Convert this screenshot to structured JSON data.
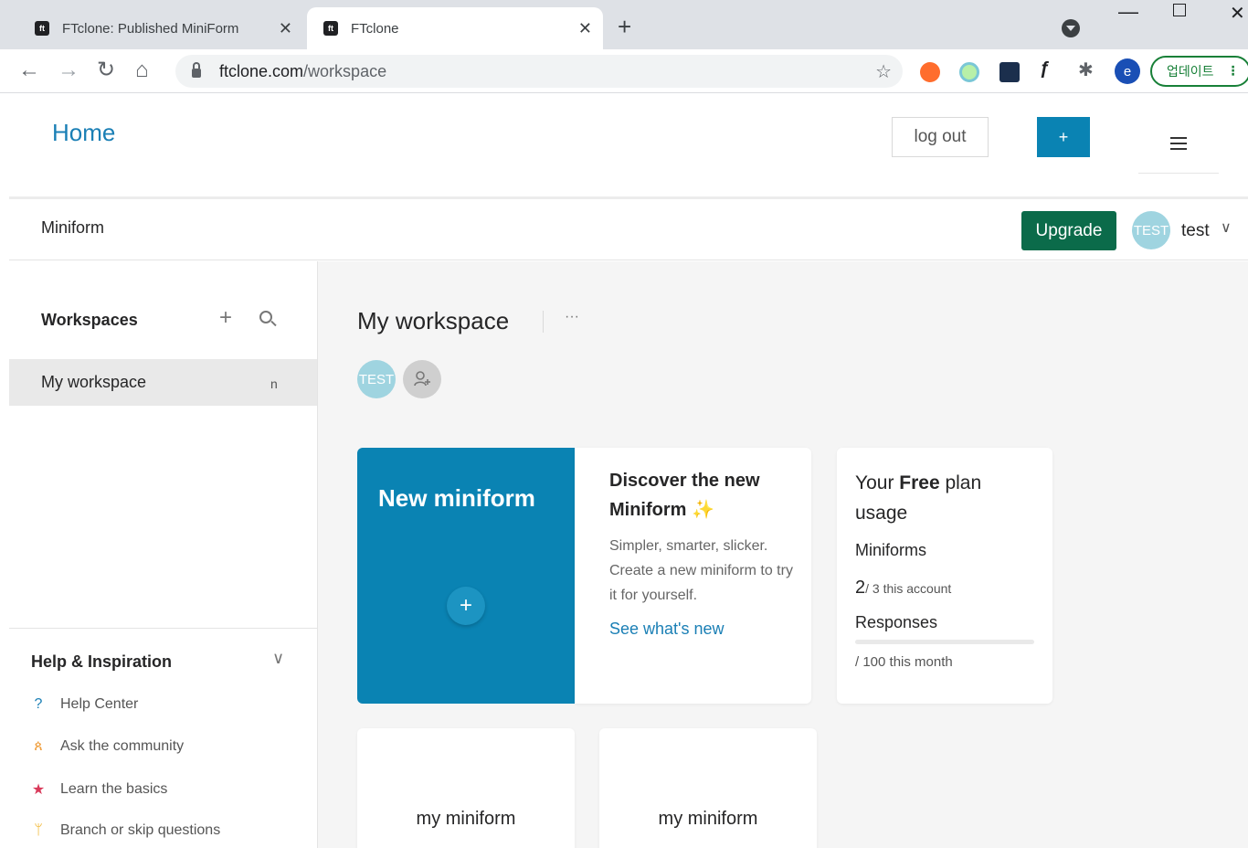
{
  "browser": {
    "tabs": [
      {
        "title": "FTclone: Published MiniForm",
        "active": false
      },
      {
        "title": "FTclone",
        "active": true
      }
    ],
    "favicon_text": "ft",
    "url_host": "ftclone.com",
    "url_path": "/workspace",
    "profile_letter": "e",
    "update_label": "업데이트"
  },
  "header": {
    "home_label": "Home",
    "logout_label": "log out",
    "plus_label": "+"
  },
  "subheader": {
    "brand": "Miniform",
    "upgrade_label": "Upgrade",
    "avatar_text": "TEST",
    "username": "test"
  },
  "sidebar": {
    "workspaces_heading": "Workspaces",
    "workspaces": [
      {
        "label": "My workspace",
        "count": "n"
      }
    ],
    "help_heading": "Help & Inspiration",
    "help_items": [
      {
        "label": "Help Center",
        "icon": "question-icon",
        "color": "#1a7fb5"
      },
      {
        "label": "Ask the community",
        "icon": "community-icon",
        "color": "#f0a040"
      },
      {
        "label": "Learn the basics",
        "icon": "star-icon",
        "color": "#d93a5a"
      },
      {
        "label": "Branch or skip questions",
        "icon": "branch-icon",
        "color": "#f0b020"
      }
    ]
  },
  "main": {
    "workspace_title": "My workspace",
    "more_label": "···",
    "member_avatar": "TEST",
    "new_card_title": "New miniform",
    "new_card_plus": "+",
    "discover": {
      "title": "Discover the new Miniform",
      "body": "Simpler, smarter, slicker. Create a new miniform to try it for yourself.",
      "link": "See what's new"
    },
    "plan": {
      "title_prefix": "Your ",
      "title_bold": "Free",
      "title_suffix": " plan usage",
      "forms_label": "Miniforms",
      "forms_used": "2",
      "forms_limit": "/ 3 this account",
      "responses_label": "Responses",
      "responses_fraction": 0.0,
      "responses_limit": "/ 100 this month"
    },
    "forms": [
      {
        "title": "my miniform"
      },
      {
        "title": "my miniform"
      }
    ]
  },
  "colors": {
    "accent": "#0a83b3",
    "upgrade": "#0b6b4a",
    "link": "#1a7fb5"
  }
}
